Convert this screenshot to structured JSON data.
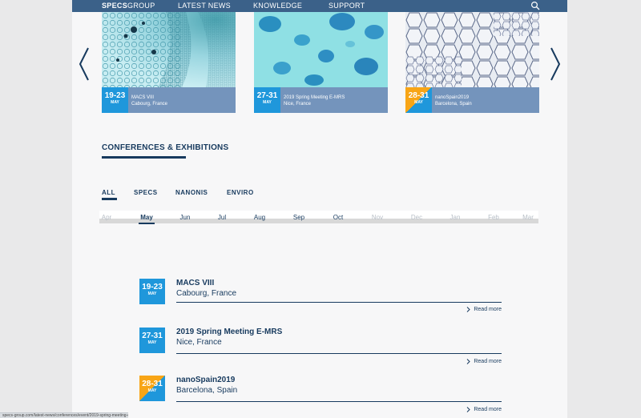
{
  "nav": {
    "logo_bold": "SPECS",
    "logo_rest": "GROUP",
    "items": [
      "LATEST NEWS",
      "KNOWLEDGE",
      "SUPPORT"
    ]
  },
  "carousel": [
    {
      "date": "19-23",
      "month": "MAY",
      "title": "MACS VIII",
      "location": "Cabourg, France"
    },
    {
      "date": "27-31",
      "month": "MAY",
      "title": "2019 Spring Meeting E-MRS",
      "location": "Nice, France"
    },
    {
      "date": "28-31",
      "month": "MAY",
      "title": "nanoSpain2019",
      "location": "Barcelona, Spain"
    }
  ],
  "section_title": "CONFERENCES & EXHIBITIONS",
  "filters": [
    "ALL",
    "SPECS",
    "NANONIS",
    "ENVIRO"
  ],
  "active_filter": "ALL",
  "months": [
    "Apr",
    "May",
    "Jun",
    "Jul",
    "Aug",
    "Sep",
    "Oct",
    "Nov",
    "Dec",
    "Jan",
    "Feb",
    "Mar"
  ],
  "active_month": "May",
  "events": [
    {
      "date": "19-23",
      "month": "MAY",
      "title": "MACS VIII",
      "location": "Cabourg, France",
      "more": "Read more"
    },
    {
      "date": "27-31",
      "month": "MAY",
      "title": "2019 Spring Meeting E-MRS",
      "location": "Nice, France",
      "more": "Read more"
    },
    {
      "date": "28-31",
      "month": "MAY",
      "title": "nanoSpain2019",
      "location": "Barcelona, Spain",
      "more": "Read more"
    }
  ],
  "status_url": "specs-group.com/latest-news/conferences/event/2019-spring-meeting-e-mrs/",
  "colors": {
    "navy": "#173a5e",
    "blue": "#1f97db",
    "orange": "#f8a516",
    "nav_bg": "#3b6189"
  }
}
